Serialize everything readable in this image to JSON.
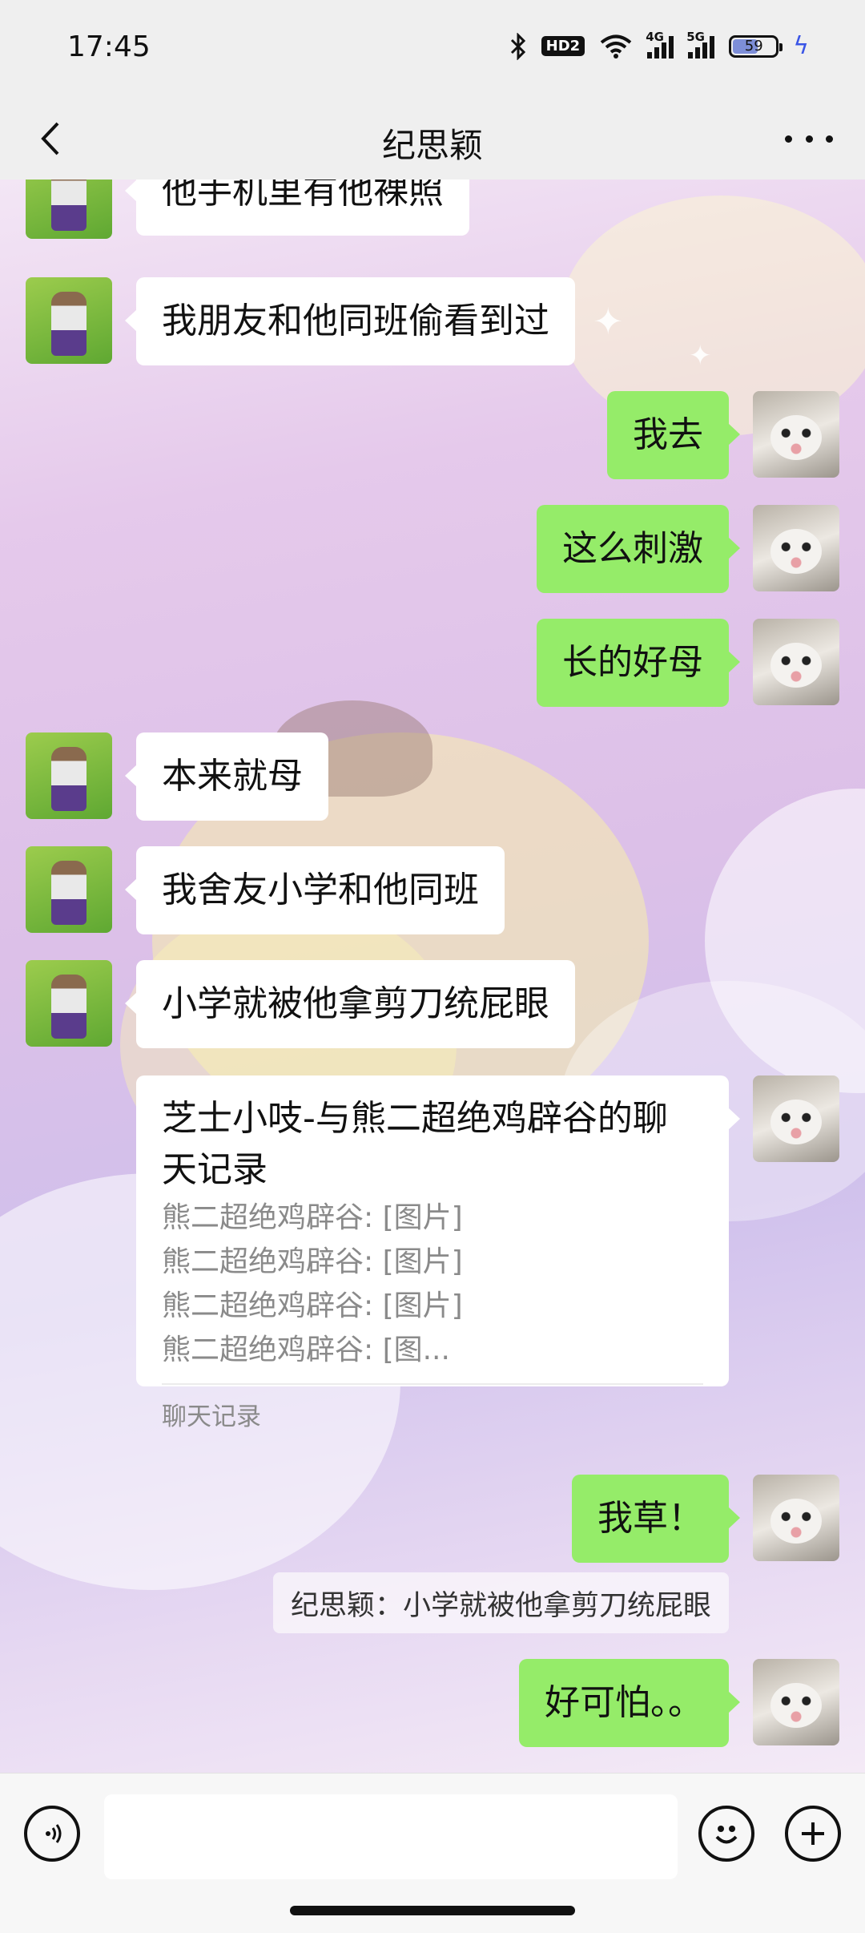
{
  "status_bar": {
    "time": "17:45",
    "hd_label": "HD2",
    "net_4g": "4G",
    "net_5g": "5G",
    "battery_level": "59"
  },
  "nav": {
    "title": "纪思颖",
    "back_icon": "chevron-left-icon",
    "more_icon": "more-dots-icon"
  },
  "messages": [
    {
      "side": "in",
      "text": "他手机里有他裸照"
    },
    {
      "side": "in",
      "text": "我朋友和他同班偷看到过"
    },
    {
      "side": "out",
      "text": "我去"
    },
    {
      "side": "out",
      "text": "这么刺激"
    },
    {
      "side": "out",
      "text": "长的好母"
    },
    {
      "side": "in",
      "text": "本来就母"
    },
    {
      "side": "in",
      "text": "我舍友小学和他同班"
    },
    {
      "side": "in",
      "text": "小学就被他拿剪刀统屁眼"
    },
    {
      "side": "out",
      "text": "我草！"
    },
    {
      "side": "out",
      "text": "好可怕。。"
    }
  ],
  "chat_record": {
    "title": "芝士小吱-与熊二超绝鸡辟谷的聊天记录",
    "lines": [
      "熊二超绝鸡辟谷: [图片]",
      "熊二超绝鸡辟谷: [图片]",
      "熊二超绝鸡辟谷: [图片]",
      "熊二超绝鸡辟谷: [图..."
    ],
    "footer": "聊天记录"
  },
  "quote": "纪思颖：小学就被他拿剪刀统屁眼",
  "input_bar": {
    "voice_icon": "voice-icon",
    "emoji_icon": "emoji-icon",
    "plus_icon": "plus-icon",
    "placeholder": ""
  },
  "colors": {
    "out_bubble": "#95ec69",
    "in_bubble": "#ffffff",
    "charging": "#3a55e6"
  }
}
